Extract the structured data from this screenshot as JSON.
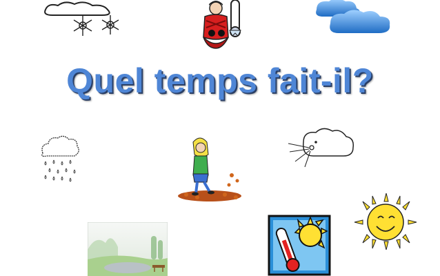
{
  "slide": {
    "title": "Quel temps fait-il?"
  },
  "illustrations": [
    {
      "name": "snow-cloud-icon"
    },
    {
      "name": "cold-person-thermometer-icon"
    },
    {
      "name": "blue-clouds-icon"
    },
    {
      "name": "rain-cloud-icon"
    },
    {
      "name": "autumn-wind-girl-icon"
    },
    {
      "name": "windy-cloud-face-icon"
    },
    {
      "name": "foggy-landscape-image"
    },
    {
      "name": "hot-thermometer-sun-icon"
    },
    {
      "name": "smiling-sun-icon"
    }
  ],
  "colors": {
    "title": "#4f86d6",
    "title_shadow": "#2a3f66",
    "cloud_blue": "#3a87d8",
    "sun_yellow": "#ffe033",
    "thermo_red": "#e32222"
  }
}
